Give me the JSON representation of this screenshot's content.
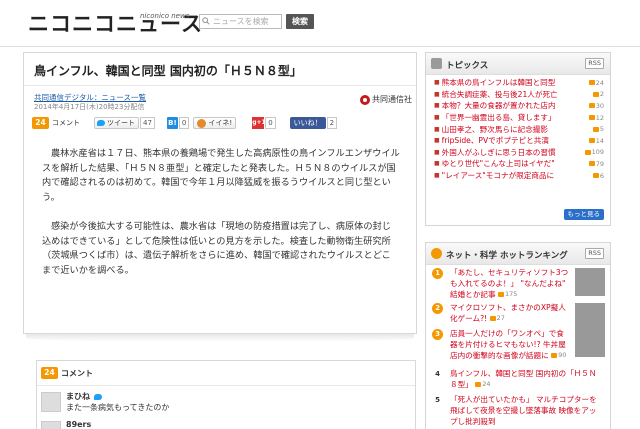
{
  "header": {
    "logo": "ニコニコニュース",
    "logo_sub": "niconico news",
    "search_placeholder": "ニュースを検索",
    "search_button": "検索"
  },
  "article": {
    "title": "鳥インフル、韓国と同型 国内初の「Ｈ５Ｎ８型」",
    "source": "共同通信デジタル：ニュース一覧",
    "timestamp": "2014年4月17日(木)20時23分配信",
    "publisher": "共同通信社",
    "comment_count": "24",
    "comment_label": "コメント",
    "tweet_label": "ツイート",
    "tweet_count": "47",
    "hatena_label": "B!",
    "hatena_count": "0",
    "mixi_label": "イイネ!",
    "gplus_label": "g+1",
    "gplus_count": "0",
    "fb_label": "いいね！",
    "fb_count": "2",
    "paragraphs": [
      "農林水産省は１７日、熊本県の養鶏場で発生した高病原性の鳥インフルエンザウイルスを解析した結果、「Ｈ５Ｎ８亜型」と確定したと発表した。Ｈ５Ｎ８のウイルスが国内で確認されるのは初めて。韓国で今年１月以降猛威を振るうウイルスと同じ型という。",
      "感染が今後拡大する可能性は、農水省は「現地の防疫措置は完了し、病原体の封じ込めはできている」として危険性は低いとの見方を示した。検査した動物衛生研究所（茨城県つくば市）は、遺伝子解析をさらに進め、韓国で確認されたウイルスとどこまで近いかを調べる。"
    ]
  },
  "comments": {
    "count": "24",
    "title": "コメント",
    "items": [
      {
        "user": "まひね",
        "text": "また一条病気もってきたのか"
      },
      {
        "user": "89ers",
        "text": ""
      }
    ]
  },
  "topics": {
    "title": "トピックス",
    "rss": "RSS",
    "more": "もっと見る",
    "items": [
      {
        "text": "熊本県の鳥インフルは韓国と同型",
        "count": "24"
      },
      {
        "text": "統合失調症薬、投与後21人が死亡",
        "count": "2"
      },
      {
        "text": "本物？大量の食器が置かれた店内",
        "count": "30"
      },
      {
        "text": "「世界一幽霊出る島、貸します」",
        "count": "12"
      },
      {
        "text": "山田孝之、野次馬らに記念撮影",
        "count": "5"
      },
      {
        "text": "fripSide、PVでポプテピと共演",
        "count": "14"
      },
      {
        "text": "外国人がふしぎに思う日本の習慣",
        "count": "109"
      },
      {
        "text": "ゆとり世代\"こんな上司はイヤだ\"",
        "count": "79"
      },
      {
        "text": "\"レイアース\"モコナが限定商品に",
        "count": "6"
      }
    ]
  },
  "ranking": {
    "title": "ネット・科学 ホットランキング",
    "rss": "RSS",
    "items": [
      {
        "rank": "1",
        "text": "「あたし、セキュリティソフト3つも入れてるのよ！」 \"なんだよね\" 結婚とか記事",
        "count": "175"
      },
      {
        "rank": "2",
        "text": "マイクロソフト、まさかのXP擬人化ゲーム?!",
        "count": "27"
      },
      {
        "rank": "3",
        "text": "店員一人だけの「ワンオペ」で食器を片付けるヒマもない!? 牛丼屋店内の衝撃的な画像が話題に",
        "count": "90"
      },
      {
        "rank": "4",
        "text": "鳥インフル、韓国と同型 国内初の「Ｈ５Ｎ８型」",
        "count": "24"
      },
      {
        "rank": "5",
        "text": "「死人が出ていたかも」 マルチコプターを飛ばして夜景を空撮し墜落事故 映像をアップし批判殺到",
        "count": ""
      }
    ]
  }
}
